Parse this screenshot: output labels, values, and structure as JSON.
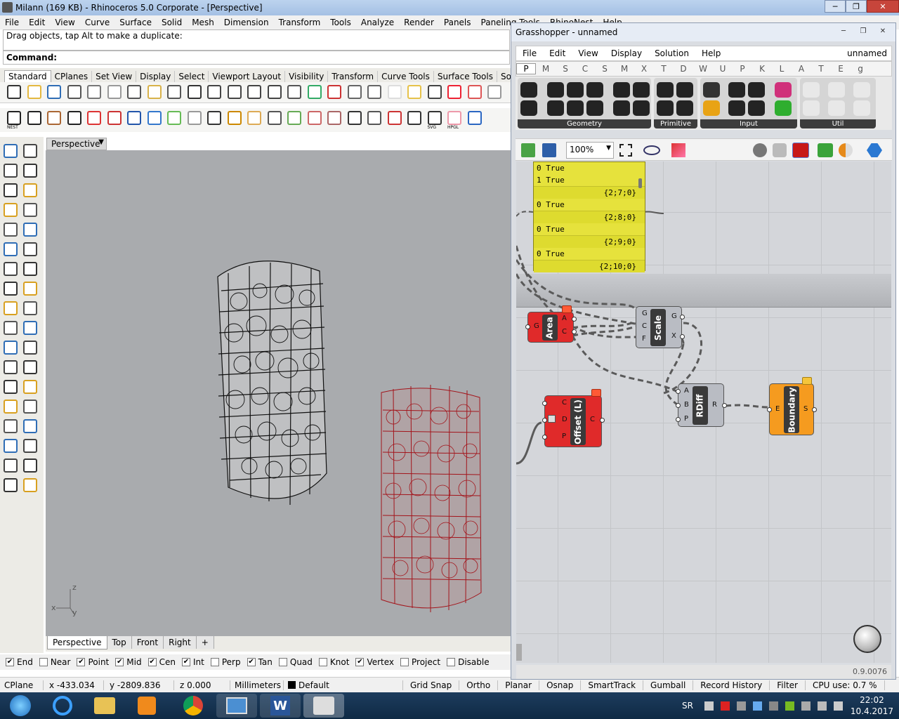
{
  "rhino": {
    "title": "Milann (169 KB) - Rhinoceros  5.0 Corporate - [Perspective]",
    "menu": [
      "File",
      "Edit",
      "View",
      "Curve",
      "Surface",
      "Solid",
      "Mesh",
      "Dimension",
      "Transform",
      "Tools",
      "Analyze",
      "Render",
      "Panels",
      "Paneling Tools",
      "RhinoNest",
      "Help"
    ],
    "command_history": "Drag objects, tap Alt to make a duplicate:",
    "command_label": "Command:",
    "toolbar_tabs": [
      "Standard",
      "CPlanes",
      "Set View",
      "Display",
      "Select",
      "Viewport Layout",
      "Visibility",
      "Transform",
      "Curve Tools",
      "Surface Tools",
      "Solid Tools"
    ],
    "toolbar_row2_labels": [
      "NEST",
      "SVG",
      "HPGL"
    ],
    "viewport_title": "Perspective",
    "axis": {
      "z": "z",
      "x": "x",
      "y": "y"
    },
    "viewport_tabs": [
      "Perspective",
      "Top",
      "Front",
      "Right",
      "+"
    ],
    "osnaps": [
      {
        "label": "End",
        "checked": true
      },
      {
        "label": "Near",
        "checked": false
      },
      {
        "label": "Point",
        "checked": true
      },
      {
        "label": "Mid",
        "checked": true
      },
      {
        "label": "Cen",
        "checked": true
      },
      {
        "label": "Int",
        "checked": true
      },
      {
        "label": "Perp",
        "checked": false
      },
      {
        "label": "Tan",
        "checked": true
      },
      {
        "label": "Quad",
        "checked": false
      },
      {
        "label": "Knot",
        "checked": false
      },
      {
        "label": "Vertex",
        "checked": true
      },
      {
        "label": "Project",
        "checked": false
      },
      {
        "label": "Disable",
        "checked": false
      }
    ],
    "status": {
      "cplane": "CPlane",
      "x": "x -433.034",
      "y": "y -2809.836",
      "z": "z 0.000",
      "units": "Millimeters",
      "layer": "Default",
      "panes": [
        "Grid Snap",
        "Ortho",
        "Planar",
        "Osnap",
        "SmartTrack",
        "Gumball",
        "Record History",
        "Filter",
        "CPU use: 0.7 %"
      ]
    }
  },
  "grasshopper": {
    "title": "Grasshopper - unnamed",
    "menu": [
      "File",
      "Edit",
      "View",
      "Display",
      "Solution",
      "Help"
    ],
    "doc_name": "unnamed",
    "categories": [
      "P",
      "M",
      "S",
      "C",
      "S",
      "M",
      "X",
      "T",
      "D",
      "W",
      "U",
      "P",
      "K",
      "L",
      "A",
      "T",
      "E",
      "g"
    ],
    "groups": [
      "Geometry",
      "Primitive",
      "Input",
      "Util"
    ],
    "zoom": "100%",
    "panel": {
      "rows": [
        {
          "type": "val",
          "text": "0 True"
        },
        {
          "type": "val",
          "text": "1 True"
        },
        {
          "type": "path",
          "text": "{2;7;0}"
        },
        {
          "type": "val",
          "text": "0 True"
        },
        {
          "type": "path",
          "text": "{2;8;0}"
        },
        {
          "type": "val",
          "text": "0 True"
        },
        {
          "type": "path",
          "text": "{2;9;0}"
        },
        {
          "type": "val",
          "text": "0 True"
        },
        {
          "type": "path",
          "text": "{2;10;0}"
        }
      ]
    },
    "components": {
      "area": {
        "name": "Area",
        "inputs": [
          "G"
        ],
        "outputs": [
          "A",
          "C"
        ]
      },
      "scale": {
        "name": "Scale",
        "inputs": [
          "G",
          "C",
          "F"
        ],
        "outputs": [
          "G",
          "X"
        ]
      },
      "offset": {
        "name": "Offset (L)",
        "inputs": [
          "C",
          "D",
          "P"
        ],
        "outputs": [
          "C"
        ]
      },
      "rdiff": {
        "name": "RDiff",
        "inputs": [
          "A",
          "B",
          "P"
        ],
        "outputs": [
          "R"
        ]
      },
      "boundary": {
        "name": "Boundary",
        "inputs": [
          "E"
        ],
        "outputs": [
          "S"
        ]
      }
    },
    "version": "0.9.0076"
  },
  "taskbar": {
    "lang": "SR",
    "time": "22:02",
    "date": "10.4.2017"
  },
  "colors": {
    "rhino_titlebar": "#b4cbe9",
    "viewport_bg": "#a9abae",
    "gh_panel": "#e6e23c",
    "gh_red": "#e02a2a",
    "gh_orange": "#f59b1f",
    "gh_grey": "#b9bcc3"
  }
}
